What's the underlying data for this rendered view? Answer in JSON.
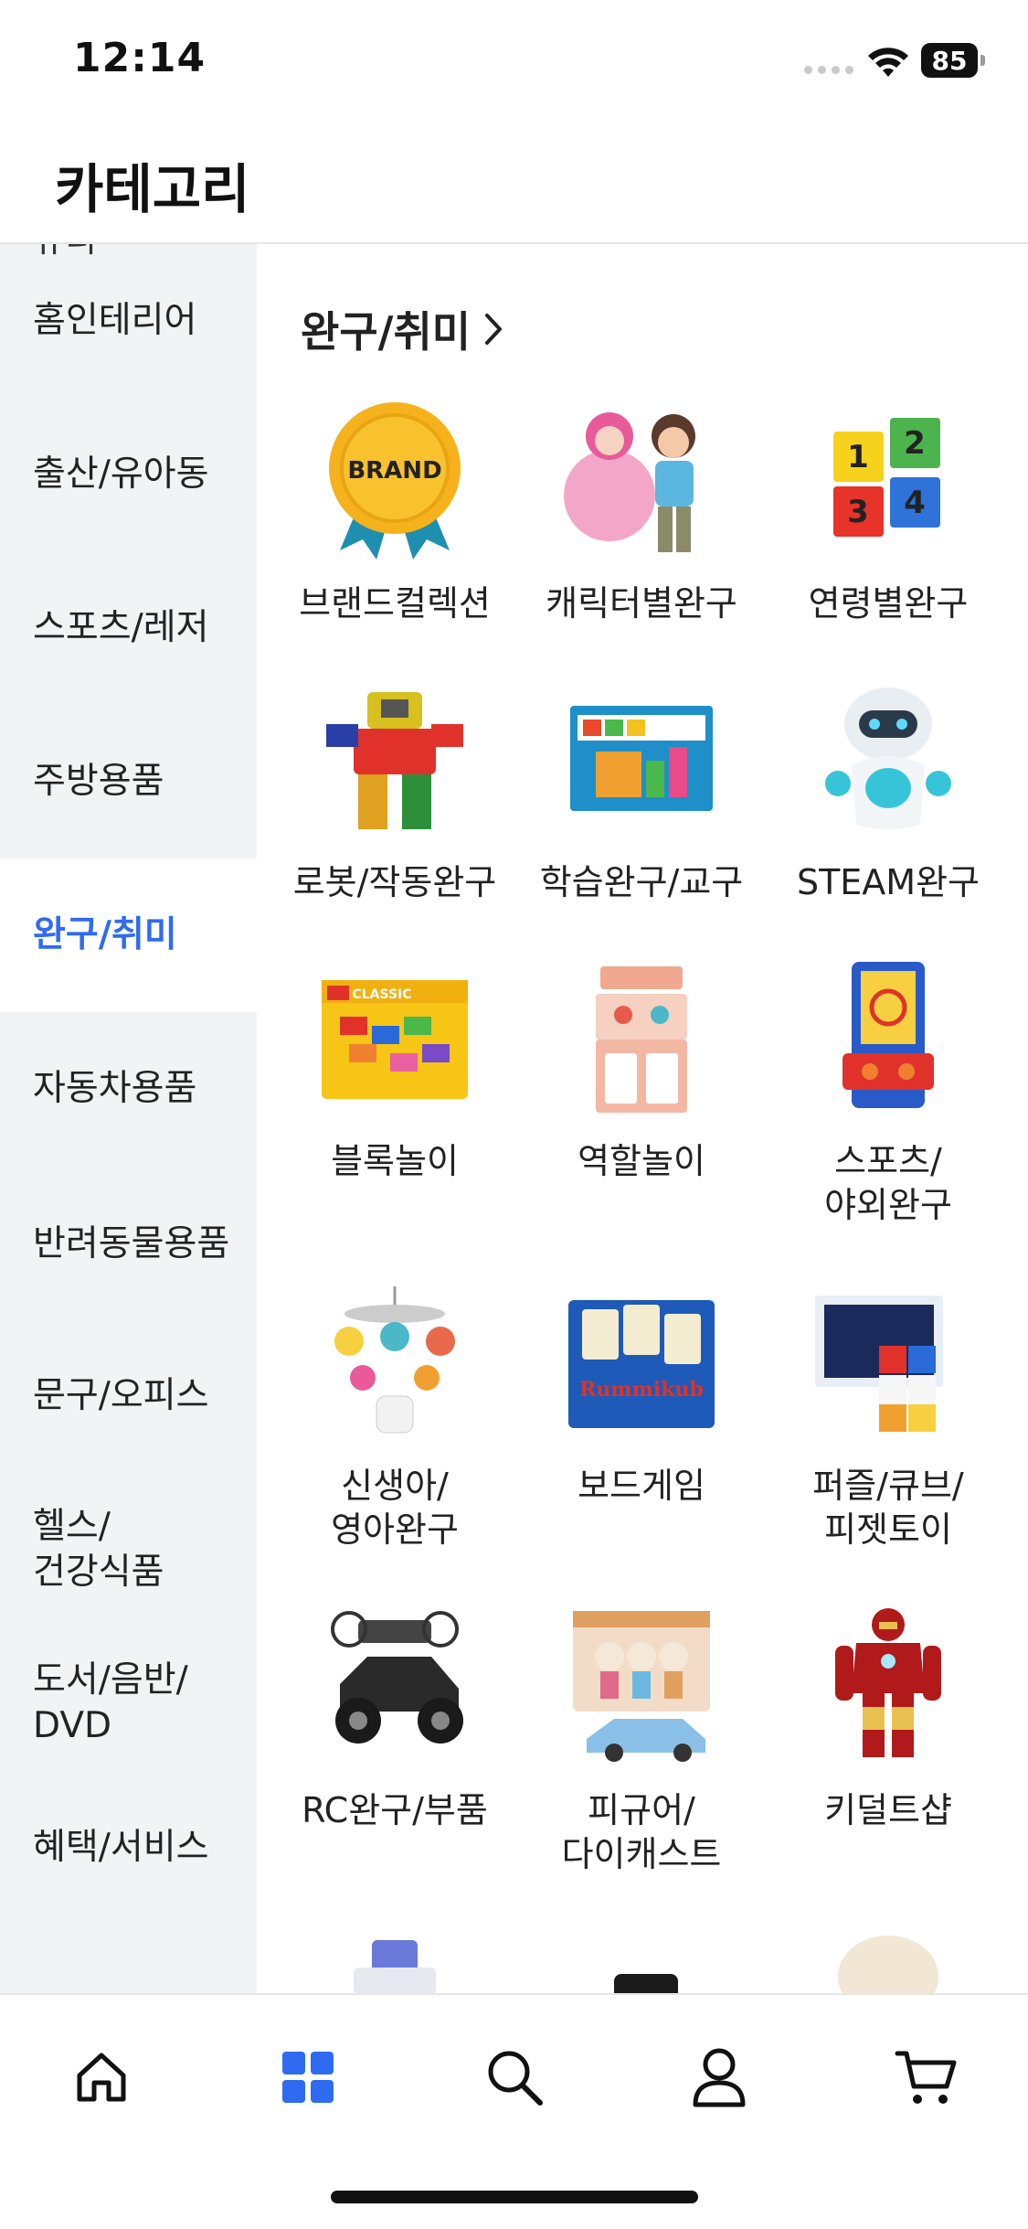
{
  "status_bar": {
    "time": "12:14",
    "battery": "85"
  },
  "header": {
    "title": "카테고리"
  },
  "sidebar": {
    "partial_top": "뷰티",
    "items": [
      {
        "label": "홈인테리어"
      },
      {
        "label": "출산/유아동"
      },
      {
        "label": "스포츠/레저"
      },
      {
        "label": "주방용품"
      },
      {
        "label": "완구/취미",
        "active": true
      },
      {
        "label": "자동차용품"
      },
      {
        "label": "반려동물용품"
      },
      {
        "label": "문구/오피스"
      },
      {
        "label": "헬스/\n건강식품"
      },
      {
        "label": "도서/음반/\nDVD"
      },
      {
        "label": "혜택/서비스"
      }
    ]
  },
  "content": {
    "section_title": "완구/취미",
    "items": [
      {
        "label": "브랜드컬렉션",
        "icon": "brand-badge-icon",
        "badge_text": "BRAND"
      },
      {
        "label": "캐릭터별완구",
        "icon": "character-figures-icon"
      },
      {
        "label": "연령별완구",
        "icon": "number-blocks-icon",
        "numbers": [
          "1",
          "2",
          "3",
          "4"
        ]
      },
      {
        "label": "로봇/작동완구",
        "icon": "robot-toy-icon"
      },
      {
        "label": "학습완구/교구",
        "icon": "learning-kit-icon"
      },
      {
        "label": "STEAM완구",
        "icon": "steam-robot-icon"
      },
      {
        "label": "블록놀이",
        "icon": "lego-box-icon",
        "box_text": "CLASSIC"
      },
      {
        "label": "역할놀이",
        "icon": "kitchen-playset-icon"
      },
      {
        "label": "스포츠/\n야외완구",
        "icon": "arcade-basketball-icon"
      },
      {
        "label": "신생아/\n영아완구",
        "icon": "baby-mobile-icon"
      },
      {
        "label": "보드게임",
        "icon": "board-game-icon",
        "box_text": "Rummikub"
      },
      {
        "label": "퍼즐/큐브/\n피젯토이",
        "icon": "puzzle-cube-icon"
      },
      {
        "label": "RC완구/부품",
        "icon": "rc-car-icon"
      },
      {
        "label": "피규어/\n다이캐스트",
        "icon": "figure-diecast-icon"
      },
      {
        "label": "키덜트샵",
        "icon": "kidult-figure-icon"
      }
    ]
  },
  "tab_bar": {
    "tabs": [
      {
        "name": "home",
        "icon": "home-icon"
      },
      {
        "name": "category",
        "icon": "grid-icon",
        "active": true
      },
      {
        "name": "search",
        "icon": "search-icon"
      },
      {
        "name": "my",
        "icon": "person-icon"
      },
      {
        "name": "cart",
        "icon": "cart-icon"
      }
    ]
  },
  "colors": {
    "accent": "#2f6bf0",
    "sidebar_bg": "#f2f3f5",
    "text": "#222222"
  }
}
